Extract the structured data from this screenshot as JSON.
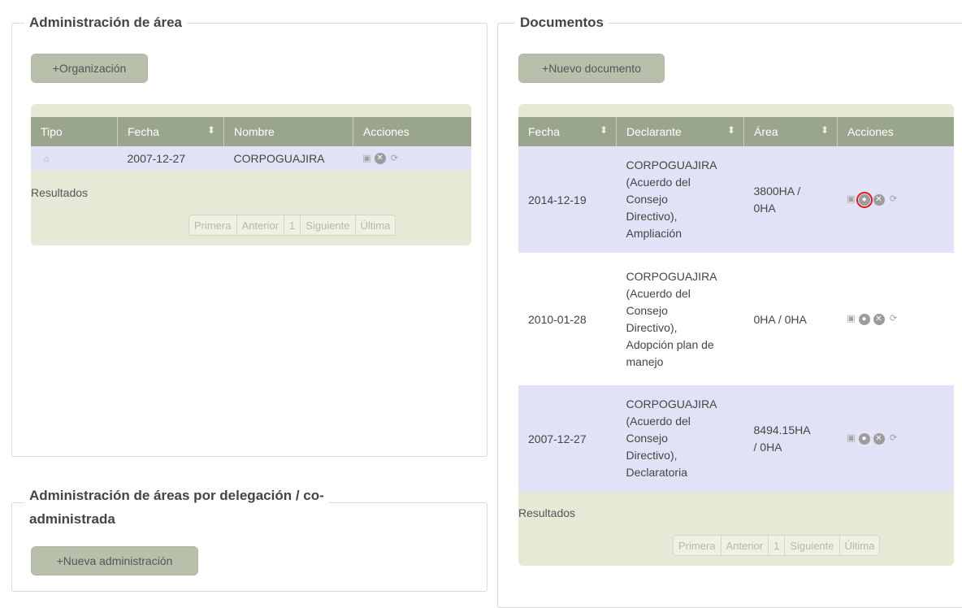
{
  "left_panel": {
    "title": "Administración de área",
    "add_button": "+Organización",
    "table": {
      "headers": [
        "Tipo",
        "Fecha",
        "Nombre",
        "Acciones"
      ],
      "rows": [
        {
          "tipo_icon": "home-icon",
          "fecha": "2007-12-27",
          "nombre": "CORPOGUAJIRA"
        }
      ]
    },
    "results_label": "Resultados",
    "pager": [
      "Primera",
      "Anterior",
      "1",
      "Siguiente",
      "Última"
    ]
  },
  "bottom_left_panel": {
    "title_line1": "Administración de áreas por delegación / co-",
    "title_line2": "administrada",
    "add_button": "+Nueva administración"
  },
  "right_panel": {
    "title": "Documentos",
    "add_button": "+Nuevo documento",
    "table": {
      "headers": [
        "Fecha",
        "Declarante",
        "Área",
        "Acciones"
      ],
      "rows": [
        {
          "fecha": "2014-12-19",
          "declarante": [
            "CORPOGUAJIRA",
            "(Acuerdo del",
            "Consejo",
            "Directivo),",
            "Ampliación"
          ],
          "area": [
            "3800HA /",
            "0HA"
          ]
        },
        {
          "fecha": "2010-01-28",
          "declarante": [
            "CORPOGUAJIRA",
            "(Acuerdo del",
            "Consejo",
            "Directivo),",
            "Adopción plan de",
            "manejo"
          ],
          "area": [
            "0HA / 0HA"
          ]
        },
        {
          "fecha": "2007-12-27",
          "declarante": [
            "CORPOGUAJIRA",
            "(Acuerdo del",
            "Consejo",
            "Directivo),",
            "Declaratoria"
          ],
          "area": [
            "8494.15HA",
            "/ 0HA"
          ]
        }
      ]
    },
    "results_label": "Resultados",
    "pager": [
      "Primera",
      "Anterior",
      "1",
      "Siguiente",
      "Última"
    ]
  },
  "icons": {
    "lock": "lock-icon",
    "view": "view-icon",
    "delete": "delete-icon",
    "sync": "sync-icon"
  },
  "colors": {
    "header_bg": "#9aa58d",
    "button_bg": "#b8bfab",
    "grid_bg": "#e8e8d6",
    "row_highlight": "#e2e2f6",
    "highlight_box": "#d92020"
  }
}
